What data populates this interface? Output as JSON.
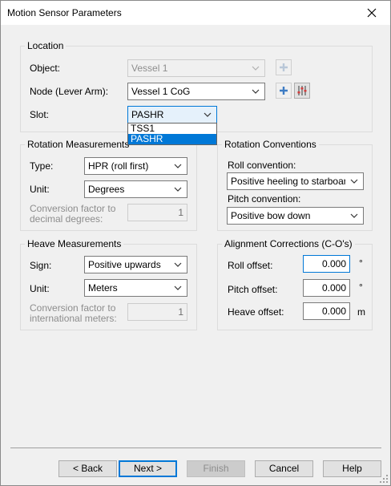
{
  "window": {
    "title": "Motion Sensor Parameters"
  },
  "location": {
    "legend": "Location",
    "object_label": "Object:",
    "object_value": "Vessel 1",
    "node_label": "Node (Lever Arm):",
    "node_value": "Vessel 1 CoG",
    "slot_label": "Slot:",
    "slot_value": "PASHR",
    "slot_options": [
      "TSS1",
      "PASHR"
    ]
  },
  "rotation_measurements": {
    "legend": "Rotation Measurements",
    "type_label": "Type:",
    "type_value": "HPR (roll first)",
    "unit_label": "Unit:",
    "unit_value": "Degrees",
    "conversion_label_line1": "Conversion factor to",
    "conversion_label_line2": "decimal degrees:",
    "conversion_value": "1"
  },
  "rotation_conventions": {
    "legend": "Rotation Conventions",
    "roll_label": "Roll convention:",
    "roll_value": "Positive heeling to starboard",
    "pitch_label": "Pitch convention:",
    "pitch_value": "Positive bow down"
  },
  "heave_measurements": {
    "legend": "Heave Measurements",
    "sign_label": "Sign:",
    "sign_value": "Positive upwards",
    "unit_label": "Unit:",
    "unit_value": "Meters",
    "conversion_label_line1": "Conversion factor to",
    "conversion_label_line2": "international meters:",
    "conversion_value": "1"
  },
  "alignment_corrections": {
    "legend": "Alignment Corrections (C-O's)",
    "roll_label": "Roll offset:",
    "roll_value": "0.000",
    "roll_unit": "°",
    "pitch_label": "Pitch offset:",
    "pitch_value": "0.000",
    "pitch_unit": "°",
    "heave_label": "Heave offset:",
    "heave_value": "0.000",
    "heave_unit": "m"
  },
  "buttons": {
    "back": "< Back",
    "next": "Next >",
    "finish": "Finish",
    "cancel": "Cancel",
    "help": "Help"
  },
  "colors": {
    "accent": "#0078d7",
    "dialog_bg": "#f0f0f0",
    "disabled_text": "#8d8d8d"
  },
  "icons": [
    "close-icon",
    "plus-icon",
    "sliders-icon",
    "chevron-down-icon",
    "resize-grip-icon"
  ]
}
